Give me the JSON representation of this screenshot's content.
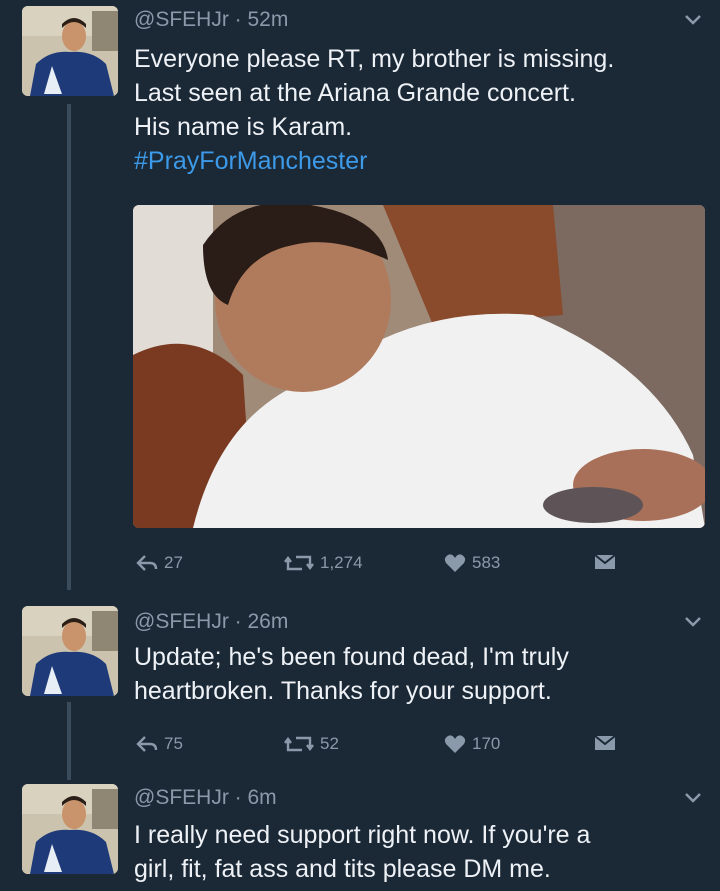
{
  "tweets": [
    {
      "handle": "@SFEHJr",
      "time": "52m",
      "lines": [
        "Everyone please RT, my brother is missing.",
        "Last seen at the Ariana Grande concert.",
        "His name is Karam."
      ],
      "hashtag": "#PrayForManchester",
      "replies": "27",
      "retweets": "1,274",
      "likes": "583"
    },
    {
      "handle": "@SFEHJr",
      "time": "26m",
      "lines": [
        "Update; he's been found dead, I'm truly",
        "heartbroken. Thanks for your support."
      ],
      "replies": "75",
      "retweets": "52",
      "likes": "170"
    },
    {
      "handle": "@SFEHJr",
      "time": "6m",
      "lines": [
        "I really need support right now. If you're a",
        "girl, fit, fat ass and tits please DM me."
      ]
    }
  ],
  "separator": " · ",
  "icons": [
    "reply-icon",
    "retweet-icon",
    "heart-icon",
    "dm-icon",
    "chevron-down-icon"
  ],
  "colors": {
    "background": "#1b2836",
    "text": "#eef2f6",
    "muted": "#8a9aab",
    "hashtag": "#3d9ae8"
  }
}
